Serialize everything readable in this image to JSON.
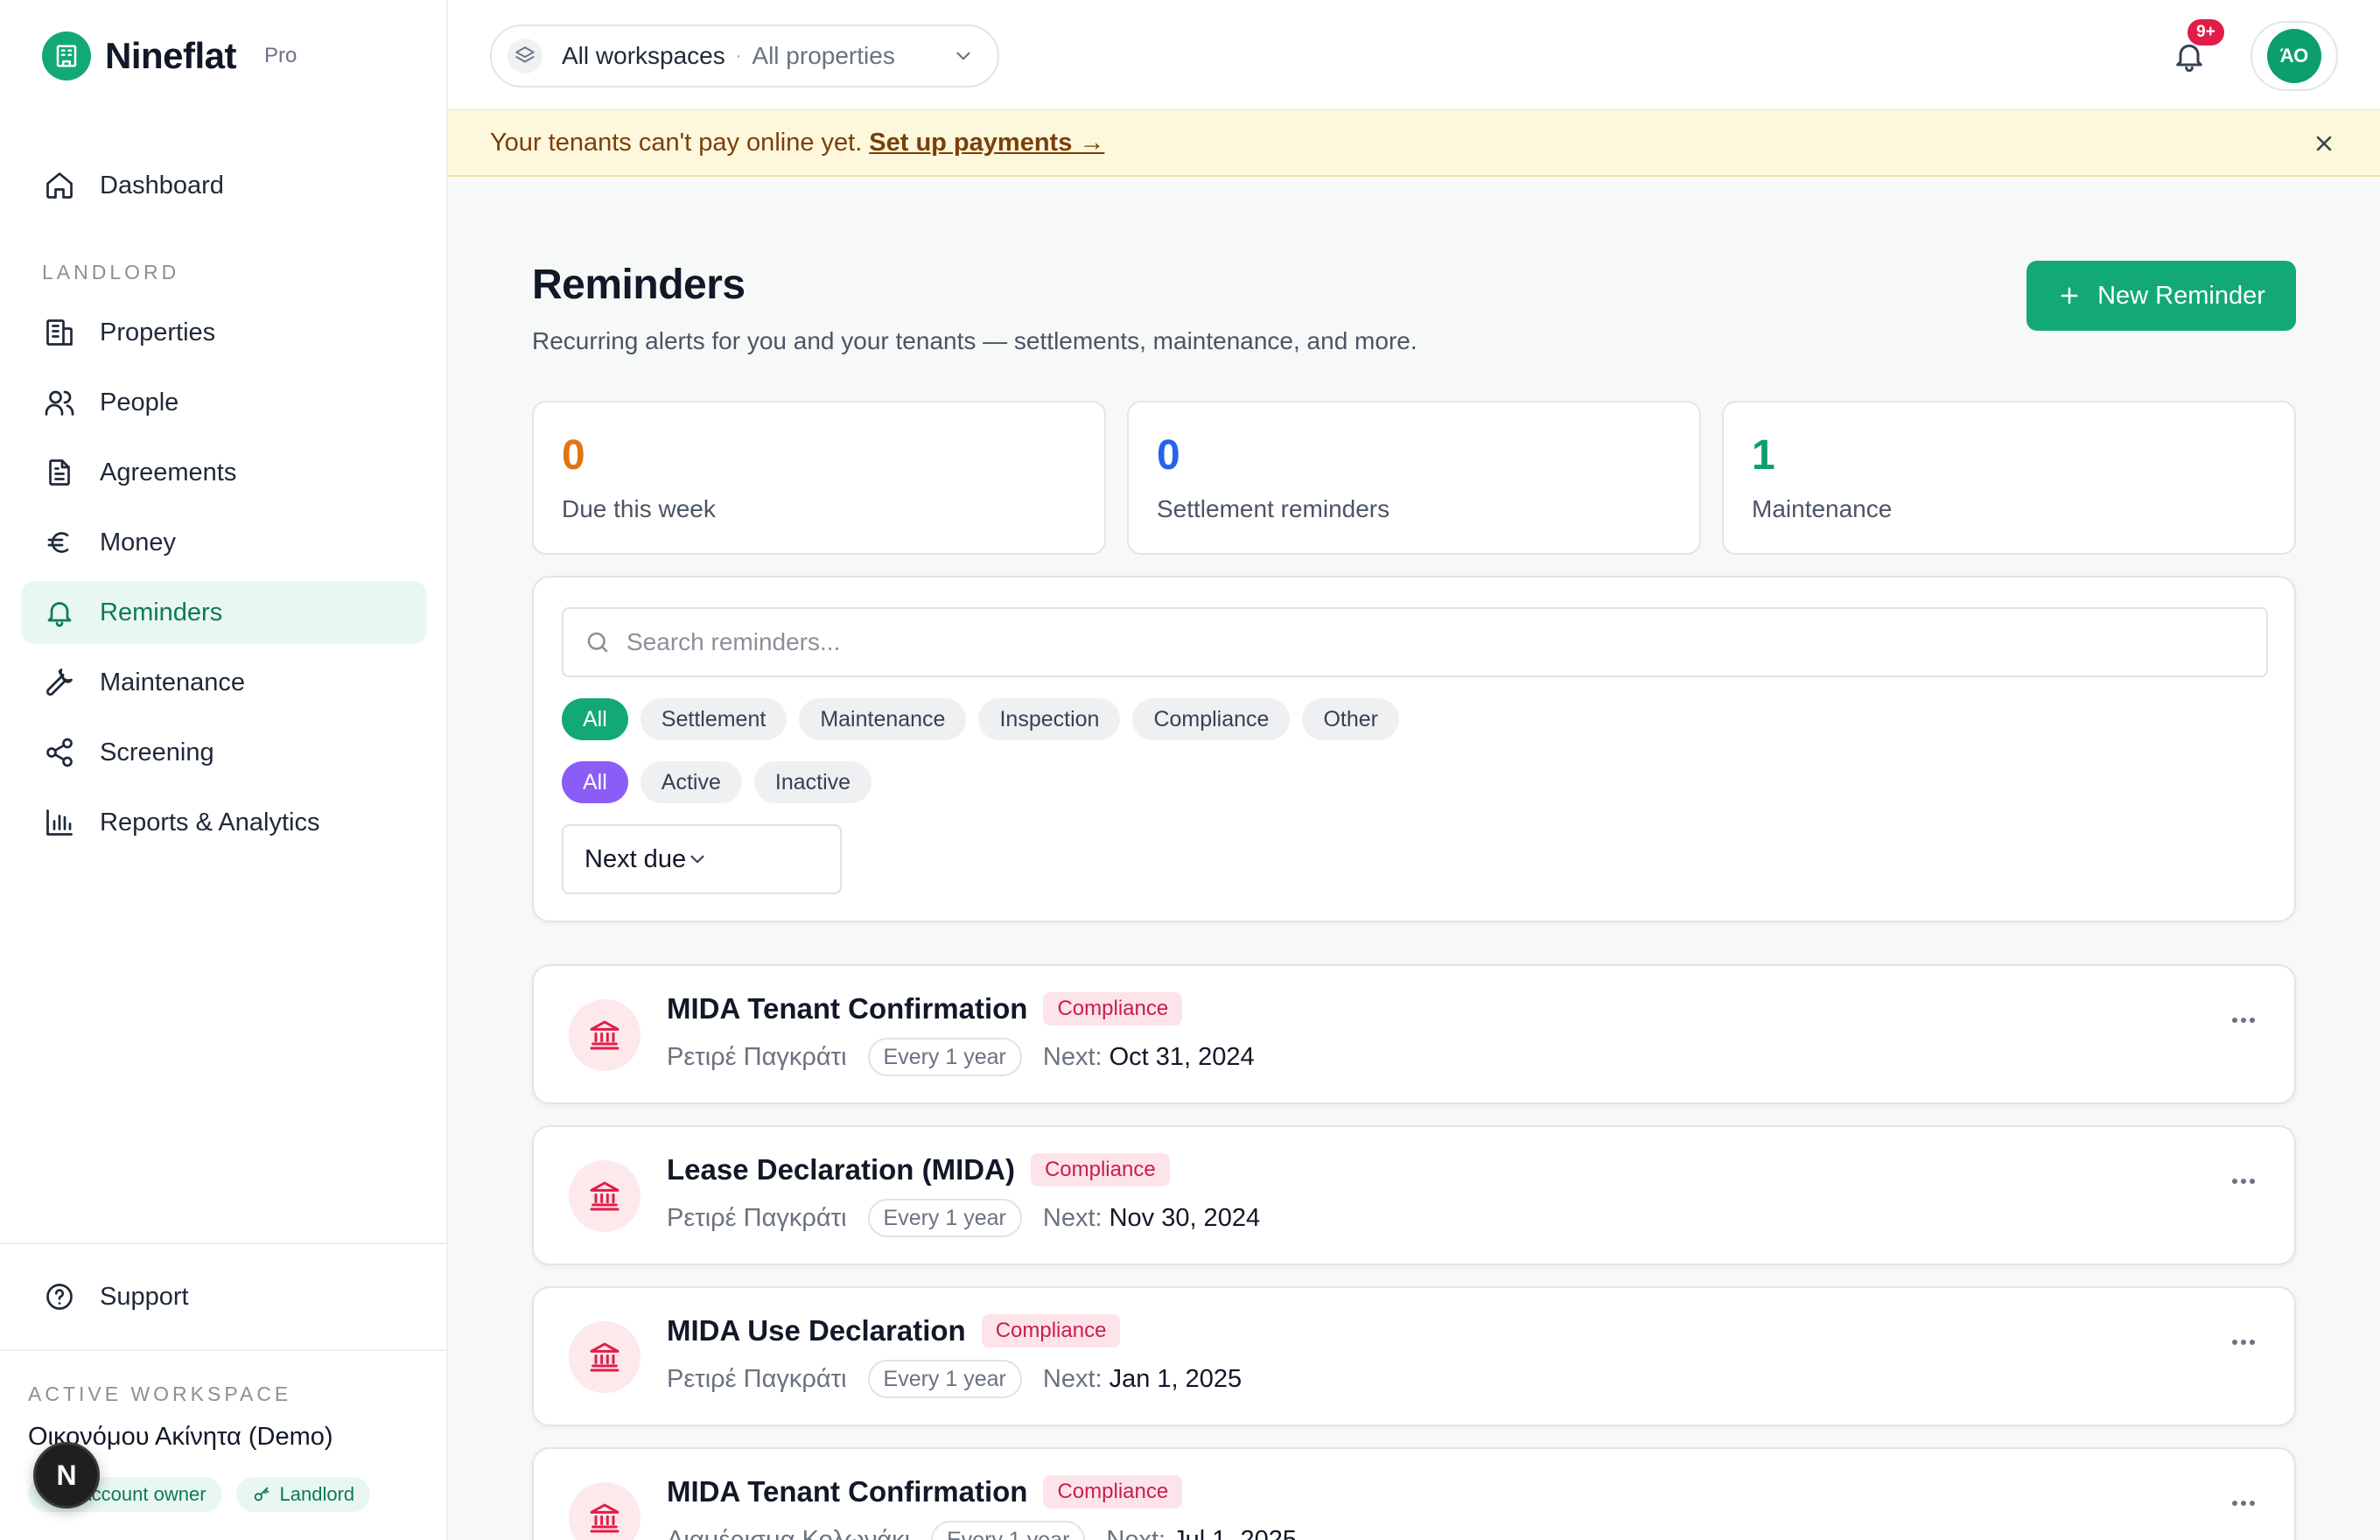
{
  "brand": {
    "name": "Nineflat",
    "tier": "Pro"
  },
  "sidebar": {
    "dashboard": "Dashboard",
    "section_landlord": "LANDLORD",
    "items": [
      {
        "label": "Properties",
        "icon": "building-icon"
      },
      {
        "label": "People",
        "icon": "people-icon"
      },
      {
        "label": "Agreements",
        "icon": "document-icon"
      },
      {
        "label": "Money",
        "icon": "euro-icon"
      },
      {
        "label": "Reminders",
        "icon": "bell-icon",
        "active": true
      },
      {
        "label": "Maintenance",
        "icon": "wrench-icon"
      },
      {
        "label": "Screening",
        "icon": "share-nodes-icon"
      },
      {
        "label": "Reports & Analytics",
        "icon": "bar-chart-icon"
      }
    ],
    "support": "Support",
    "active_workspace_label": "ACTIVE WORKSPACE",
    "workspace_name": "Οικονόμου Ακίνητα (Demo)",
    "role_badges": [
      "Account owner",
      "Landlord"
    ],
    "fab_letter": "N"
  },
  "topbar": {
    "workspace_primary": "All workspaces",
    "workspace_separator": "·",
    "workspace_secondary": "All properties",
    "notifications_count": "9+",
    "avatar_initials": "ΆΟ"
  },
  "banner": {
    "text": "Your tenants can't pay online yet.",
    "link": "Set up payments →"
  },
  "page": {
    "title": "Reminders",
    "subtitle": "Recurring alerts for you and your tenants — settlements, maintenance, and more.",
    "new_button": "New Reminder"
  },
  "stats": [
    {
      "value": "0",
      "label": "Due this week",
      "color": "#e07511"
    },
    {
      "value": "0",
      "label": "Settlement reminders",
      "color": "#2563eb"
    },
    {
      "value": "1",
      "label": "Maintenance",
      "color": "#0b9f6e"
    }
  ],
  "filters": {
    "search_placeholder": "Search reminders...",
    "categories": [
      "All",
      "Settlement",
      "Maintenance",
      "Inspection",
      "Compliance",
      "Other"
    ],
    "statuses": [
      "All",
      "Active",
      "Inactive"
    ],
    "sort": "Next due"
  },
  "reminders": [
    {
      "title": "MIDA Tenant Confirmation",
      "tag": "Compliance",
      "property": "Ρετιρέ Παγκράτι",
      "frequency": "Every 1 year",
      "next_label": "Next:",
      "next": "Oct 31, 2024"
    },
    {
      "title": "Lease Declaration (MIDA)",
      "tag": "Compliance",
      "property": "Ρετιρέ Παγκράτι",
      "frequency": "Every 1 year",
      "next_label": "Next:",
      "next": "Nov 30, 2024"
    },
    {
      "title": "MIDA Use Declaration",
      "tag": "Compliance",
      "property": "Ρετιρέ Παγκράτι",
      "frequency": "Every 1 year",
      "next_label": "Next:",
      "next": "Jan 1, 2025"
    },
    {
      "title": "MIDA Tenant Confirmation",
      "tag": "Compliance",
      "property": "Διαμέρισμα Κολωνάκι",
      "frequency": "Every 1 year",
      "next_label": "Next:",
      "next": "Jul 1, 2025"
    }
  ]
}
